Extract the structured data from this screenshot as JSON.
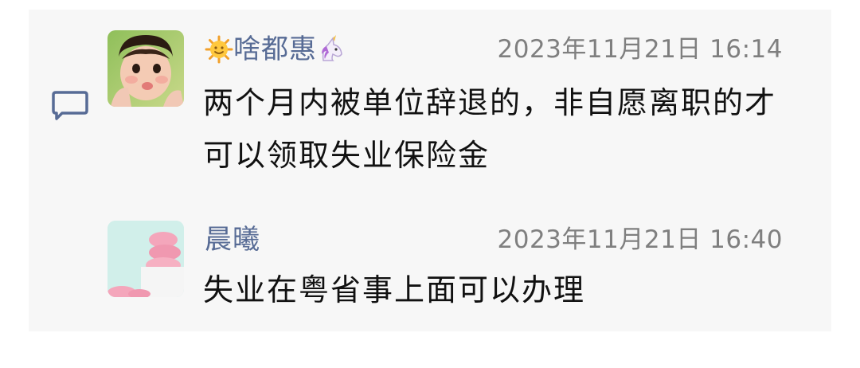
{
  "comments": [
    {
      "name": "啥都惠",
      "prefix_icon": "sun-emoji",
      "suffix_icon": "unicorn-emoji",
      "time": "2023年11月21日 16:14",
      "text": "两个月内被单位辞退的，非自愿离职的才可以领取失业保险金"
    },
    {
      "name": "晨曦",
      "time": "2023年11月21日 16:40",
      "text": "失业在粤省事上面可以办理"
    }
  ],
  "colors": {
    "name": "#576b95",
    "time": "#7f7f7f",
    "text": "#111111",
    "panel": "#f7f7f7",
    "comment_icon": "#576b95"
  }
}
